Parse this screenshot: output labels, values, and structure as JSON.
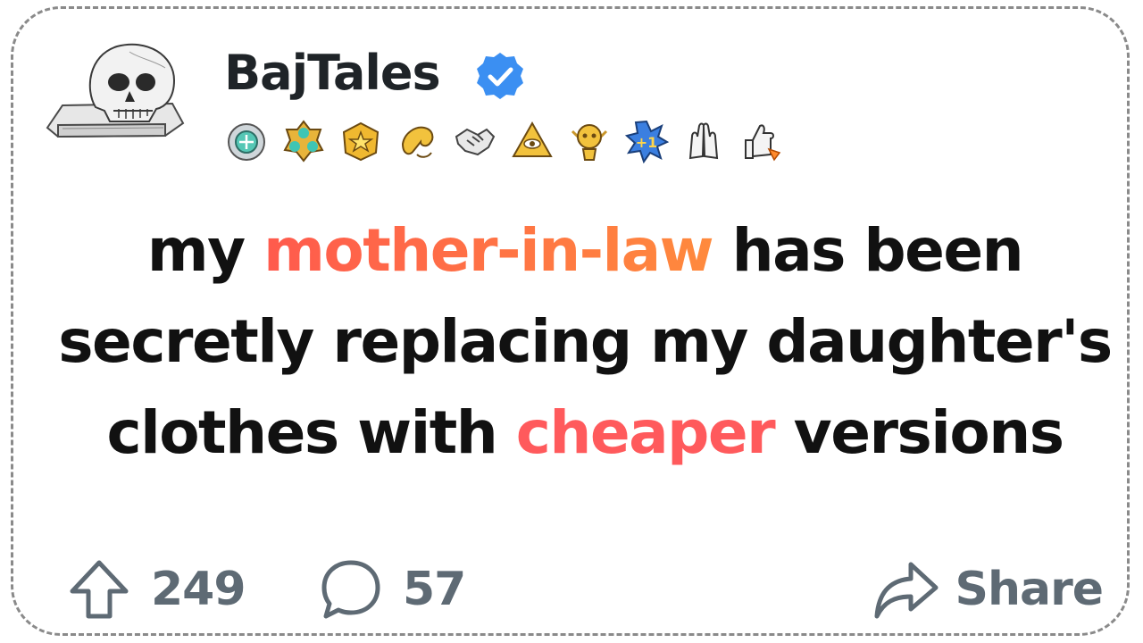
{
  "post": {
    "author": {
      "username": "BajTales",
      "avatar_icon": "skull-on-book-icon",
      "verified_icon": "verified-check-icon",
      "verified_color": "#3b8ff2"
    },
    "badges": [
      {
        "icon": "silver-medal-icon"
      },
      {
        "icon": "gold-teal-gem-icon"
      },
      {
        "icon": "gold-star-badge-icon"
      },
      {
        "icon": "gold-hand-gesture-icon"
      },
      {
        "icon": "handshake-icon"
      },
      {
        "icon": "gold-pyramid-eye-icon"
      },
      {
        "icon": "gold-robot-icon"
      },
      {
        "icon": "plus-one-starburst-icon"
      },
      {
        "icon": "high-five-hands-icon"
      },
      {
        "icon": "thumbs-up-rocket-icon"
      }
    ],
    "title": {
      "part1": "my ",
      "highlight1": "mother-in-law",
      "part2": " has been secretly replacing my daughter's clothes with ",
      "highlight2": "cheaper",
      "part3": " versions"
    },
    "colors": {
      "highlight1_start": "#ff5a4d",
      "highlight1_end": "#ff8a3d",
      "highlight2": "#ff5a5c",
      "action_gray": "#5e6a74"
    },
    "actions": {
      "upvote_count": "249",
      "upvote_icon": "upvote-arrow-icon",
      "comment_count": "57",
      "comment_icon": "comment-bubble-icon",
      "share_label": "Share",
      "share_icon": "share-arrow-icon"
    }
  }
}
